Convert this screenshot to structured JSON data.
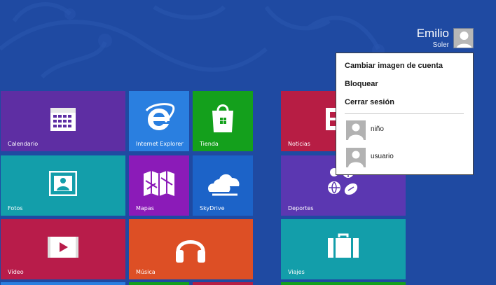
{
  "user": {
    "first_name": "Emilio",
    "last_name": "Soler",
    "avatar_icon": "person-silhouette-icon"
  },
  "account_menu": {
    "items": [
      "Cambiar imagen de cuenta",
      "Bloquear",
      "Cerrar sesión"
    ],
    "other_accounts": [
      "niño",
      "usuario"
    ]
  },
  "tiles": [
    {
      "label": "Calendario",
      "icon": "calendar-icon",
      "color": "#5e2ea3"
    },
    {
      "label": "Internet Explorer",
      "icon": "internet-explorer-icon",
      "color": "#2a7fe0"
    },
    {
      "label": "Tienda",
      "icon": "shopping-bag-icon",
      "color": "#14a01c"
    },
    {
      "label": "Noticias",
      "icon": "newspaper-icon",
      "color": "#b71d44"
    },
    {
      "label": "Fotos",
      "icon": "photo-icon",
      "color": "#139eaa"
    },
    {
      "label": "Mapas",
      "icon": "map-icon",
      "color": "#8b1bb8"
    },
    {
      "label": "SkyDrive",
      "icon": "cloud-icon",
      "color": "#1c63c8"
    },
    {
      "label": "Deportes",
      "icon": "sports-balls-icon",
      "color": "#5b37b1"
    },
    {
      "label": "Vídeo",
      "icon": "video-play-icon",
      "color": "#b81c4a"
    },
    {
      "label": "Música",
      "icon": "headphones-icon",
      "color": "#dd4f25"
    },
    {
      "label": "Viajes",
      "icon": "suitcase-icon",
      "color": "#139eaa"
    }
  ],
  "colors": {
    "background": "#1f4aa2",
    "menu_background": "#ffffff",
    "menu_text": "#1a1a1a"
  }
}
